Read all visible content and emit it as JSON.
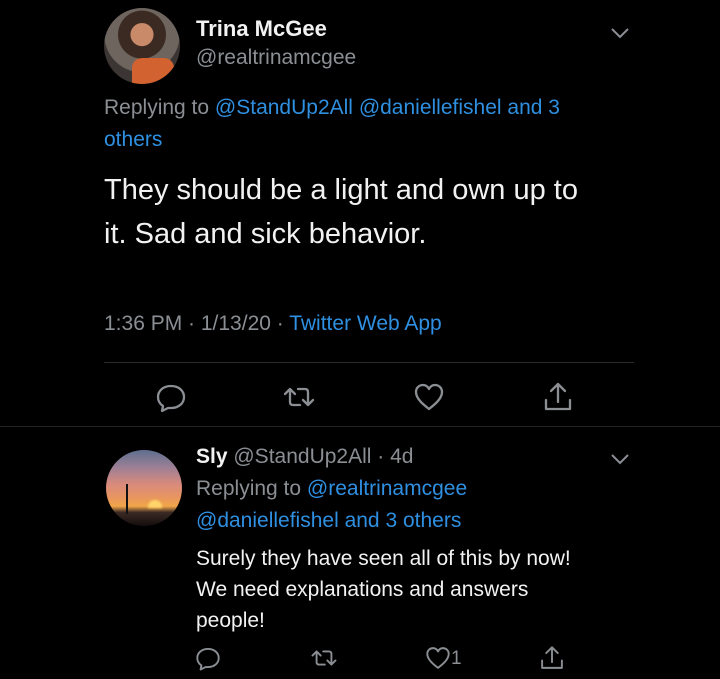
{
  "tweet": {
    "author_name": "Trina McGee",
    "author_handle": "@realtrinamcgee",
    "replying_prefix": "Replying to ",
    "replying_mention_1": "@StandUp2All",
    "replying_mention_2": "@daniellefishel",
    "replying_others": "and 3",
    "replying_others_2": "others",
    "text_line_1": "They should be a light and own up to",
    "text_line_2": "it. Sad and sick behavior.",
    "time": "1:36 PM · 1/13/20 · ",
    "source": "Twitter Web App"
  },
  "reply": {
    "author_name": "Sly",
    "author_handle_time": " @StandUp2All · 4d",
    "replying_prefix": "Replying to ",
    "replying_mention_1": "@realtrinamcgee",
    "replying_line_2": "@daniellefishel and 3 others",
    "text_line_1": "Surely they have seen all of this by now!",
    "text_line_2": "We need explanations and answers",
    "text_line_3": "people!",
    "like_count": "1"
  },
  "colors": {
    "background": "#000000",
    "link": "#2f8fe0",
    "muted": "#8b8f94",
    "text": "#f2f2f2"
  },
  "icons": [
    "chevron-down-icon",
    "reply-icon",
    "retweet-icon",
    "like-icon",
    "share-icon"
  ]
}
